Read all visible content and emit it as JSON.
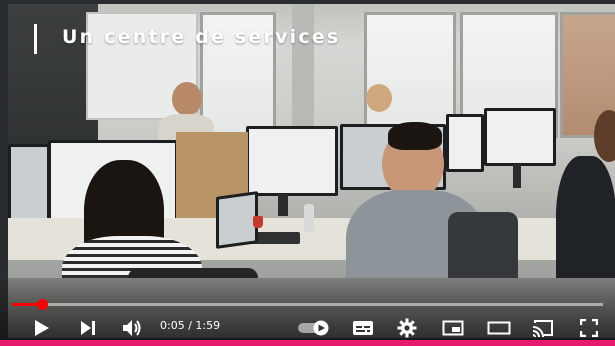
{
  "video": {
    "title_overlay": "Un centre de services",
    "progress_fraction": 0.051,
    "current_time": "0:05",
    "separator": " / ",
    "duration": "1:59"
  },
  "controls": {
    "play_icon": "play-icon",
    "next_icon": "next-icon",
    "volume_icon": "volume-icon",
    "autoplay_icon": "autoplay-toggle-icon",
    "subtitles_icon": "subtitles-icon",
    "settings_icon": "gear-icon",
    "miniplayer_icon": "miniplayer-icon",
    "theater_icon": "theater-mode-icon",
    "cast_icon": "cast-icon",
    "fullscreen_icon": "fullscreen-icon"
  },
  "colors": {
    "progress_played": "#ff0000",
    "page_accent_bar": "#e71a6e"
  }
}
